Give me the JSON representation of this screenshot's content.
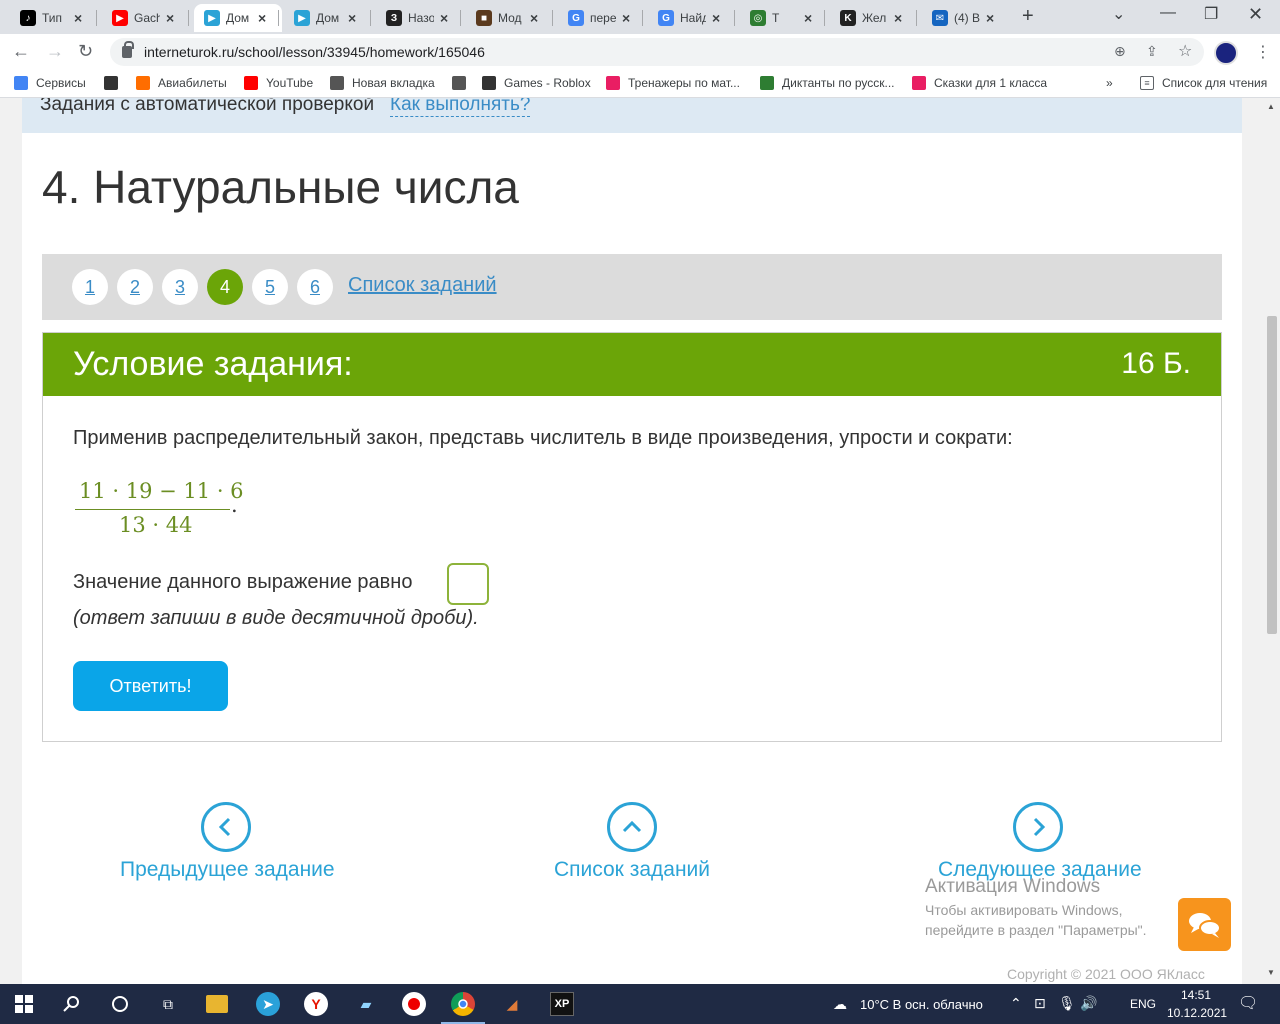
{
  "browser": {
    "tabs": [
      {
        "title": "Тип",
        "icon": "tiktok-icon",
        "color": "#000000",
        "glyph": "♪"
      },
      {
        "title": "Gach",
        "icon": "youtube-icon",
        "color": "#ff0000",
        "glyph": "▶"
      },
      {
        "title": "Дом",
        "icon": "interneturok-icon",
        "color": "#2ba3d6",
        "glyph": "▶",
        "active": true
      },
      {
        "title": "Дом",
        "icon": "interneturok-icon",
        "color": "#2ba3d6",
        "glyph": "▶"
      },
      {
        "title": "Назо",
        "icon": "z-icon",
        "color": "#222222",
        "glyph": "З"
      },
      {
        "title": "Мод",
        "icon": "minecraft-icon",
        "color": "#5b3a1e",
        "glyph": "■"
      },
      {
        "title": "пере",
        "icon": "google-icon",
        "color": "#4285f4",
        "glyph": "G"
      },
      {
        "title": "Найд",
        "icon": "google-icon",
        "color": "#4285f4",
        "glyph": "G"
      },
      {
        "title": "Т",
        "icon": "spiral-icon",
        "color": "#2e7d32",
        "glyph": "◎"
      },
      {
        "title": "Жел",
        "icon": "k-icon",
        "color": "#222222",
        "glyph": "K"
      },
      {
        "title": "(4) В",
        "icon": "mail-icon",
        "color": "#1565c0",
        "glyph": "✉"
      }
    ],
    "address": "interneturok.ru/school/lesson/33945/homework/165046",
    "bookmarks": [
      {
        "label": "Сервисы",
        "icon": "apps-icon",
        "color": "#4285f4"
      },
      {
        "label": "",
        "icon": "roblox-icon",
        "color": "#333333"
      },
      {
        "label": "Авиабилеты",
        "icon": "plane-icon",
        "color": "#ff6d00"
      },
      {
        "label": "YouTube",
        "icon": "youtube-icon",
        "color": "#ff0000"
      },
      {
        "label": "Новая вкладка",
        "icon": "globe-icon",
        "color": "#555555"
      },
      {
        "label": "",
        "icon": "globe-icon",
        "color": "#555555"
      },
      {
        "label": "Games - Roblox",
        "icon": "roblox-icon",
        "color": "#333333"
      },
      {
        "label": "Тренажеры по мат...",
        "icon": "hand-icon",
        "color": "#e91e63"
      },
      {
        "label": "Диктанты по русск...",
        "icon": "leaf-icon",
        "color": "#2e7d32"
      },
      {
        "label": "Сказки для 1 класса",
        "icon": "flamingo-icon",
        "color": "#e91e63"
      }
    ],
    "bookmarks_more": "»",
    "reading_list": "Список для чтения"
  },
  "page": {
    "autocheck_text": "Задания с автоматической проверкой",
    "howto_link": "Как выполнять?",
    "lesson_title": "4. Натуральные числа",
    "pager": {
      "pages": [
        "1",
        "2",
        "3",
        "4",
        "5",
        "6"
      ],
      "active_page": "4",
      "task_list_link": "Список заданий"
    },
    "task": {
      "header": "Условие задания:",
      "points": "16 Б.",
      "text": "Применив распределительный закон, представь числитель в виде произведения, упрости и сократи:",
      "fraction_numerator": "11 · 19 − 11 · 6",
      "fraction_denominator": "13 · 44",
      "fraction_punct": ".",
      "answer_label": "Значение данного выражение равно",
      "answer_value": "",
      "answer_hint": "(ответ запиши в виде десятичной дроби).",
      "submit_label": "Ответить!"
    },
    "navigation": {
      "prev": "Предыдущее задание",
      "list": "Список заданий",
      "next": "Следующее задание"
    },
    "watermark": {
      "title": "Активация Windows",
      "text": "Чтобы активировать Windows, перейдите в раздел \"Параметры\"."
    },
    "copyright": "Copyright © 2021 ООО ЯКласс"
  },
  "taskbar": {
    "weather": "10°C  В осн. облачно",
    "lang": "ENG",
    "time": "14:51",
    "date": "10.12.2021"
  },
  "colors": {
    "green": "#6ba508",
    "blue_link": "#3a8cc6",
    "button_blue": "#0aa5e8",
    "chat_orange": "#f7941d"
  }
}
